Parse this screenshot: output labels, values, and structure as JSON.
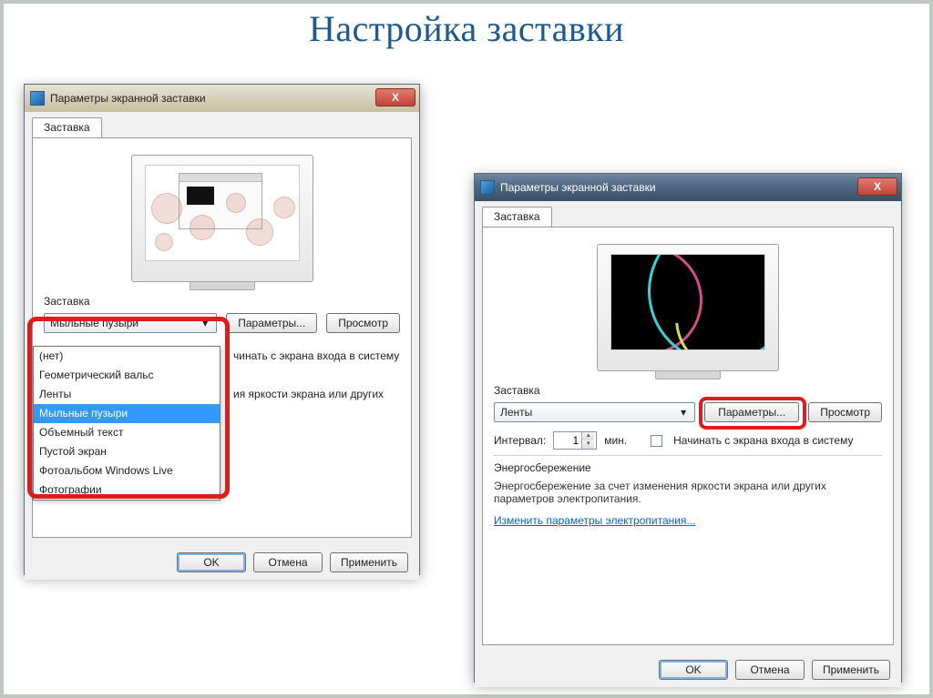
{
  "page": {
    "title": "Настройка заставки"
  },
  "dialog": {
    "title": "Параметры экранной заставки",
    "tab": "Заставка",
    "close": "X",
    "section_label": "Заставка",
    "params_btn": "Параметры...",
    "preview_btn": "Просмотр",
    "interval_label": "Интервал:",
    "interval_value": "1",
    "interval_unit": "мин.",
    "checkbox_label": "Начинать с экрана входа в систему",
    "power_heading": "Энергосбережение",
    "power_text1": "Энергосбережение за счет изменения яркости экрана или других",
    "power_text2": "параметров электропитания.",
    "power_link": "Изменить параметры электропитания...",
    "ok": "OK",
    "cancel": "Отмена",
    "apply": "Применить"
  },
  "left": {
    "selected_saver": "Мыльные пузыри",
    "trunc_text": "чинать с экрана входа в систему",
    "trunc_text2": "ия яркости экрана или других",
    "options": [
      "(нет)",
      "Геометрический вальс",
      "Ленты",
      "Мыльные пузыри",
      "Объемный текст",
      "Пустой экран",
      "Фотоальбом Windows Live",
      "Фотографии"
    ],
    "selected_index": 3
  },
  "right": {
    "selected_saver": "Ленты"
  }
}
